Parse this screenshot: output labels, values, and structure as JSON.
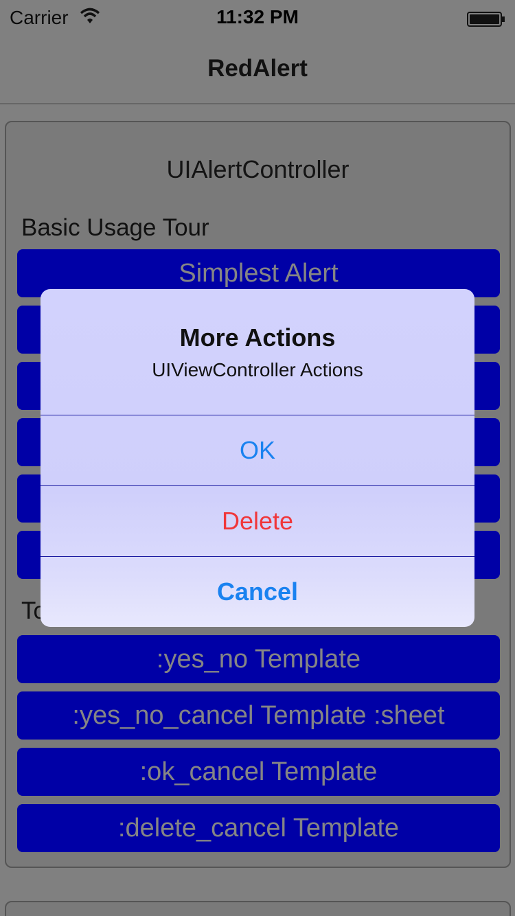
{
  "status_bar": {
    "carrier": "Carrier",
    "time": "11:32 PM",
    "wifi_icon": "wifi-icon",
    "battery_icon": "battery-icon"
  },
  "nav": {
    "title": "RedAlert"
  },
  "panel": {
    "heading": "UIAlertController",
    "section1_label": "Basic Usage Tour",
    "section1_buttons": [
      "Simplest Alert",
      "",
      "",
      "",
      "",
      ""
    ],
    "section2_label": "To",
    "section2_buttons": [
      ":yes_no Template",
      ":yes_no_cancel Template :sheet",
      ":ok_cancel Template",
      ":delete_cancel Template"
    ]
  },
  "alert": {
    "title": "More Actions",
    "message": "UIViewController Actions",
    "actions": [
      {
        "label": "OK",
        "style": "default",
        "color": "#1a82f0"
      },
      {
        "label": "Delete",
        "style": "destructive",
        "color": "#f0363a"
      },
      {
        "label": "Cancel",
        "style": "cancel",
        "color": "#1a82f0"
      }
    ]
  },
  "colors": {
    "background": "#808080",
    "button_fill": "#0000a6",
    "button_text": "#858585",
    "alert_fill": "#d2d2fd"
  }
}
